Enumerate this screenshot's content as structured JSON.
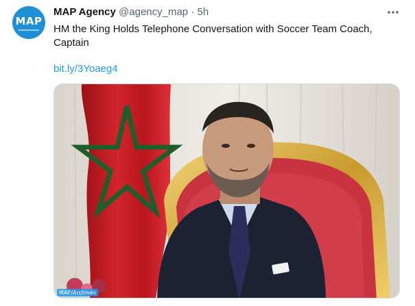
{
  "tweet": {
    "avatar_text": "MAP",
    "author_name": "MAP Agency",
    "author_handle": "@agency_map",
    "separator": " · ",
    "timestamp": "5h",
    "text": "HM the King Holds Telephone Conversation with Soccer Team Coach, Captain",
    "link": "bit.ly/3Yoaeg4",
    "image_credit": "MAP/Archives"
  },
  "colors": {
    "link": "#1d9bf0",
    "secondary_text": "#536471",
    "avatar_bg": "#1f8fd6"
  },
  "icons": {
    "more": "more-horizontal-icon"
  }
}
